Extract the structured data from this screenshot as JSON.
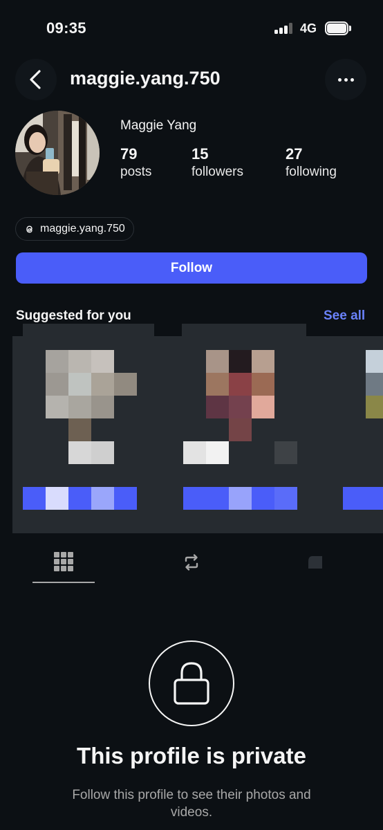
{
  "status_bar": {
    "time": "09:35",
    "network": "4G",
    "signal_bars_active": 3,
    "battery_level": 1.0
  },
  "header": {
    "username": "maggie.yang.750",
    "back_icon": "chevron-left-icon",
    "more_icon": "more-horizontal-icon"
  },
  "profile": {
    "display_name": "Maggie Yang",
    "stats": {
      "posts": {
        "value": "79",
        "label": "posts"
      },
      "followers": {
        "value": "15",
        "label": "followers"
      },
      "following": {
        "value": "27",
        "label": "following"
      }
    },
    "threads_handle": "maggie.yang.750",
    "follow_label": "Follow"
  },
  "suggested": {
    "title": "Suggested for you",
    "see_all": "See all"
  },
  "tabs": [
    {
      "icon": "grid-icon",
      "active": true
    },
    {
      "icon": "reposts-icon",
      "active": false
    },
    {
      "icon": "tagged-icon",
      "active": false
    }
  ],
  "private_notice": {
    "title": "This profile is private",
    "subtitle": "Follow this profile to see their photos and videos."
  },
  "colors": {
    "background": "#0c1014",
    "accent": "#4a5df9",
    "link": "#6a82fb",
    "muted_text": "#a8a8a8"
  }
}
